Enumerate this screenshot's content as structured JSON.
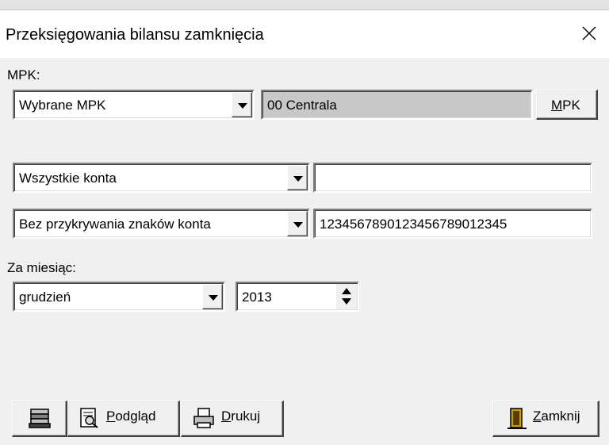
{
  "window": {
    "title": "Przeksięgowania bilansu zamknięcia"
  },
  "mpk": {
    "label": "MPK:",
    "selector_value": "Wybrane MPK",
    "selected_display": "00  Centrala",
    "button_key": "M",
    "button_rest": "PK"
  },
  "accounts": {
    "filter_value": "Wszystkie konta",
    "filter_text": ""
  },
  "masking": {
    "mode_value": "Bez przykrywania znaków konta",
    "mask_text": "1234567890123456789012345"
  },
  "period": {
    "label": "Za miesiąc:",
    "month_value": "grudzień",
    "year_value": "2013"
  },
  "footer": {
    "preview_key": "P",
    "preview_rest": "odgląd",
    "print_key": "D",
    "print_rest": "rukuj",
    "close_key": "Z",
    "close_rest": "amknij"
  },
  "icons": {
    "settings": "stack-printer-icon",
    "preview": "preview-document-icon",
    "print": "printer-icon",
    "close": "door-exit-icon",
    "window_close": "close-icon"
  }
}
